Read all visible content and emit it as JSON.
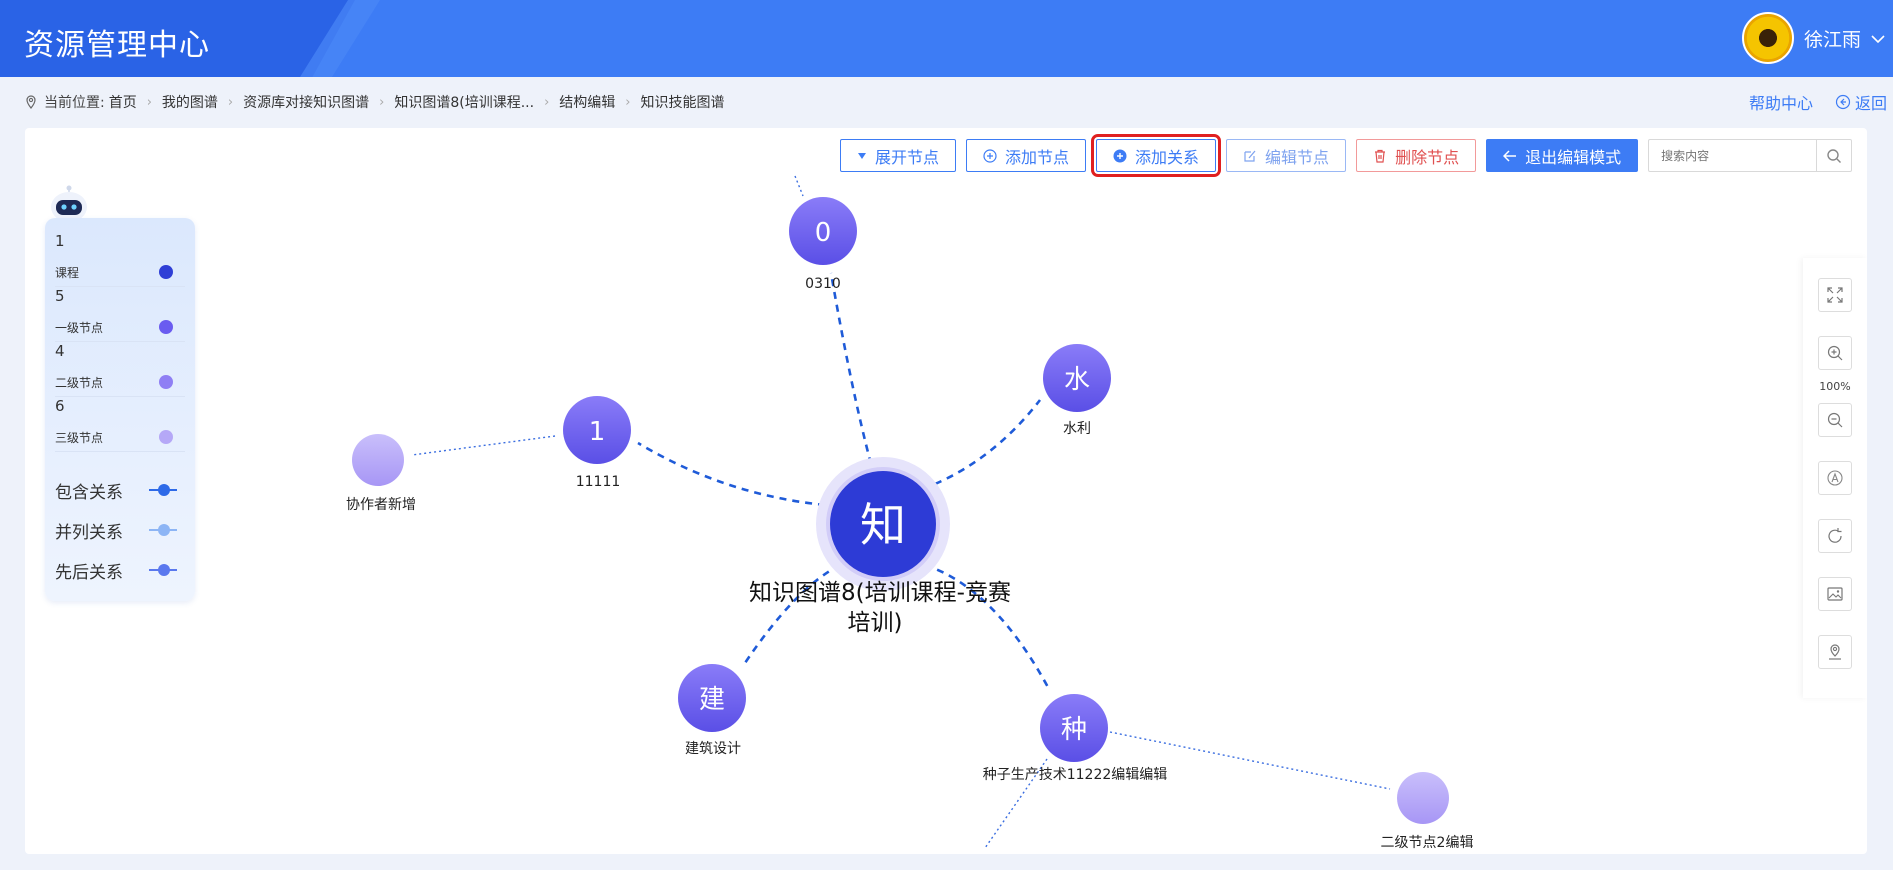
{
  "header": {
    "app_title": "资源管理中心",
    "user_name": "徐江雨"
  },
  "breadcrumb": {
    "prefix": "当前位置:",
    "items": [
      "首页",
      "我的图谱",
      "资源库对接知识图谱",
      "知识图谱8(培训课程...",
      "结构编辑",
      "知识技能图谱"
    ]
  },
  "right_links": {
    "help": "帮助中心",
    "back": "返回"
  },
  "toolbar": {
    "expand": "展开节点",
    "add_node": "添加节点",
    "add_relation": "添加关系",
    "edit_node": "编辑节点",
    "delete_node": "删除节点",
    "exit_edit": "退出编辑模式",
    "search_placeholder": "搜索内容"
  },
  "legend": {
    "levels": [
      {
        "count": "1",
        "name": "课程",
        "color": "#2f3fd6"
      },
      {
        "count": "5",
        "name": "一级节点",
        "color": "#6a5cf0"
      },
      {
        "count": "4",
        "name": "二级节点",
        "color": "#8f7ff4"
      },
      {
        "count": "6",
        "name": "三级节点",
        "color": "#b5a8f7"
      }
    ],
    "relations": [
      {
        "name": "包含关系",
        "color": "#2e6ae8"
      },
      {
        "name": "并列关系",
        "color": "#8db5f5"
      },
      {
        "name": "先后关系",
        "color": "#5a78ee"
      }
    ]
  },
  "graph": {
    "center": {
      "glyph": "知",
      "label_line1": "知识图谱8(培训课程-竞赛",
      "label_line2": "培训)"
    },
    "nodes": [
      {
        "glyph": "0",
        "label": "0310"
      },
      {
        "glyph": "水",
        "label": "水利"
      },
      {
        "glyph": "1",
        "label": "11111"
      },
      {
        "glyph": "",
        "label": "协作者新增"
      },
      {
        "glyph": "建",
        "label": "建筑设计"
      },
      {
        "glyph": "种",
        "label": "种子生产技术11222编辑编辑"
      },
      {
        "glyph": "",
        "label": "二级节点2编辑"
      }
    ]
  },
  "tools": {
    "zoom_level": "100%"
  }
}
